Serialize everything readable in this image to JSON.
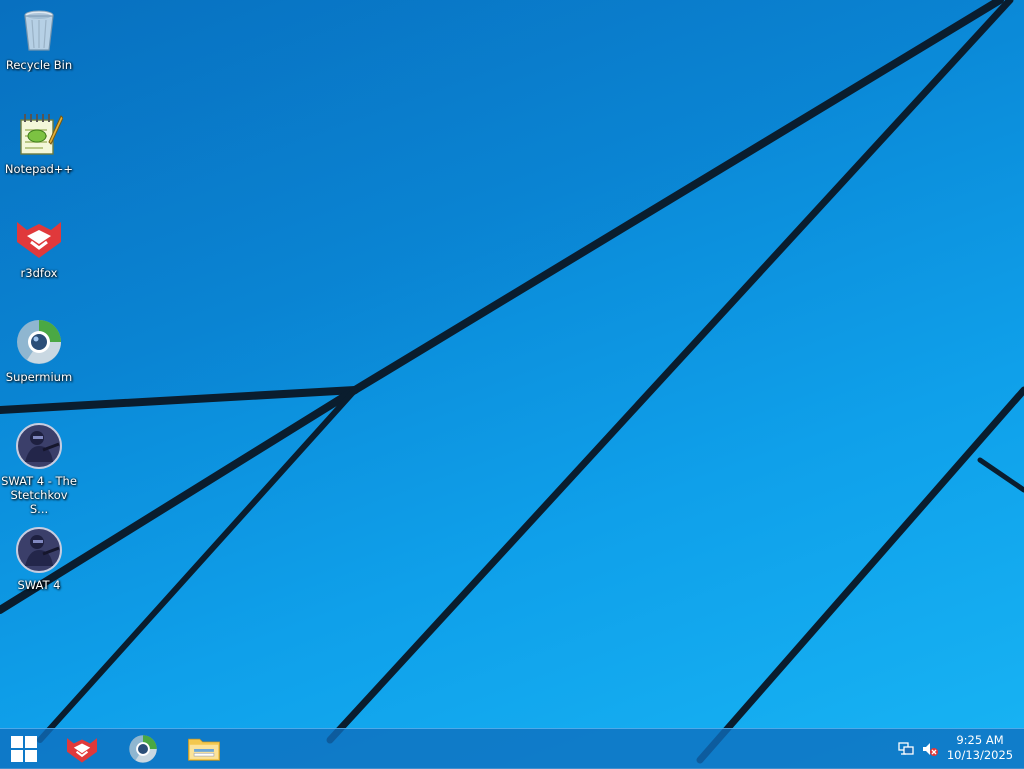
{
  "desktop": {
    "icons": [
      {
        "label": "Recycle Bin",
        "icon": "recycle-bin-icon"
      },
      {
        "label": "Notepad++",
        "icon": "notepad-plus-plus-icon"
      },
      {
        "label": "r3dfox",
        "icon": "r3dfox-icon"
      },
      {
        "label": "Supermium",
        "icon": "supermium-icon"
      },
      {
        "label": "SWAT 4 - The Stetchkov S...",
        "icon": "swat4-icon"
      },
      {
        "label": "SWAT 4",
        "icon": "swat4-icon"
      }
    ]
  },
  "taskbar": {
    "start_icon": "windows-logo-icon",
    "pinned": [
      {
        "icon": "r3dfox-icon"
      },
      {
        "icon": "supermium-icon"
      },
      {
        "icon": "file-explorer-icon"
      }
    ],
    "tray_icons": [
      "network-icon",
      "volume-muted-icon"
    ],
    "clock": {
      "time": "9:25 AM",
      "date": "10/13/2025"
    }
  },
  "colors": {
    "wallpaper_blue": "#0b8ad8",
    "taskbar": "#0e6ebe",
    "r3dfox_red": "#e03b3b"
  }
}
